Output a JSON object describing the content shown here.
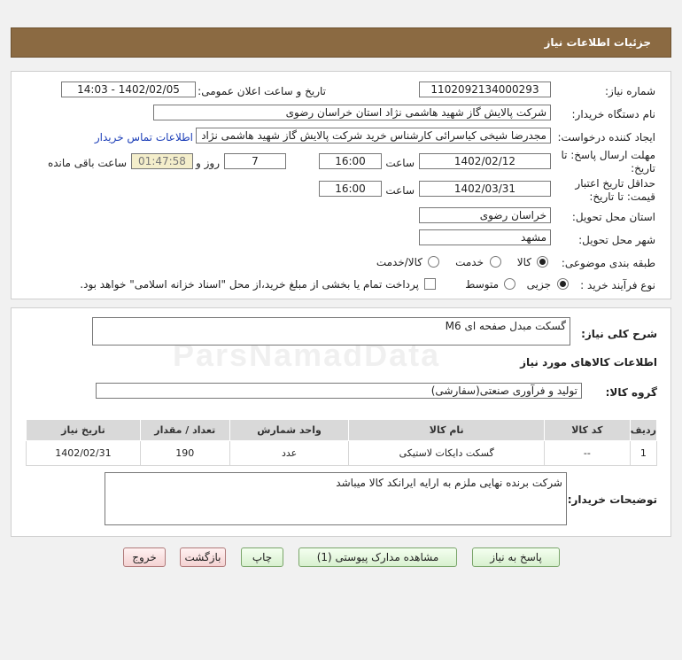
{
  "header": {
    "title": "جزئیات اطلاعات نیاز"
  },
  "form": {
    "need_number_label": "شماره نیاز:",
    "need_number": "1102092134000293",
    "announce_label": "تاریخ و ساعت اعلان عمومی:",
    "announce_value": "1402/02/05 - 14:03",
    "buyer_org_label": "نام دستگاه خریدار:",
    "buyer_org": "شرکت پالایش گاز شهید هاشمی نژاد   استان خراسان رضوی",
    "requester_label": "ایجاد کننده درخواست:",
    "requester": "مجدرضا شیخی کیاسرائی کارشناس خرید شرکت پالایش گاز شهید هاشمی نژاد",
    "contact_link": "اطلاعات تماس خریدار",
    "deadline_label_1": "مهلت ارسال پاسخ: تا",
    "deadline_label_2": "تاریخ:",
    "deadline_date": "1402/02/12",
    "time_label": "ساعت",
    "deadline_time": "16:00",
    "days_value": "7",
    "days_label": "روز و",
    "remaining_time": "01:47:58",
    "remaining_label": "ساعت باقی مانده",
    "validity_label_1": "حداقل تاریخ اعتبار",
    "validity_label_2": "قیمت: تا تاریخ:",
    "validity_date": "1402/03/31",
    "validity_time": "16:00",
    "province_label": "استان محل تحویل:",
    "province": "خراسان رضوی",
    "city_label": "شهر محل تحویل:",
    "city": "مشهد",
    "category_label": "طبقه بندی موضوعی:",
    "category_options": [
      "کالا",
      "خدمت",
      "کالا/خدمت"
    ],
    "category_selected": "کالا",
    "process_label": "نوع فرآیند خرید :",
    "process_options": [
      "جزیی",
      "متوسط"
    ],
    "process_selected": "جزیی",
    "payment_note": "پرداخت تمام یا بخشی از مبلغ خرید،از محل \"اسناد خزانه اسلامی\" خواهد بود."
  },
  "details": {
    "description_label": "شرح کلی نیاز:",
    "description": "گسکت مبدل صفحه ای M6",
    "items_heading": "اطلاعات کالاهای مورد نیاز",
    "goods_group_label": "گروه کالا:",
    "goods_group": "تولید و فرآوری صنعتی(سفارشی)",
    "table": {
      "headers": [
        "ردیف",
        "کد کالا",
        "نام کالا",
        "واحد شمارش",
        "تعداد / مقدار",
        "تاریخ نیاز"
      ],
      "rows": [
        [
          "1",
          "--",
          "گسکت دایکات لاستیکی",
          "عدد",
          "190",
          "1402/02/31"
        ]
      ]
    },
    "buyer_notes_label": "توضیحات خریدار:",
    "buyer_notes": "شرکت برنده نهایی ملزم به ارایه ایرانکد کالا میباشد"
  },
  "buttons": {
    "reply": "پاسخ به نیاز",
    "attachments": "مشاهده مدارک پیوستی (1)",
    "print": "چاپ",
    "back": "بازگشت",
    "exit": "خروج"
  },
  "colors": {
    "header_bg": "#8b6a42",
    "link": "#1d3fb8",
    "remaining_bg": "#f4eecb"
  }
}
